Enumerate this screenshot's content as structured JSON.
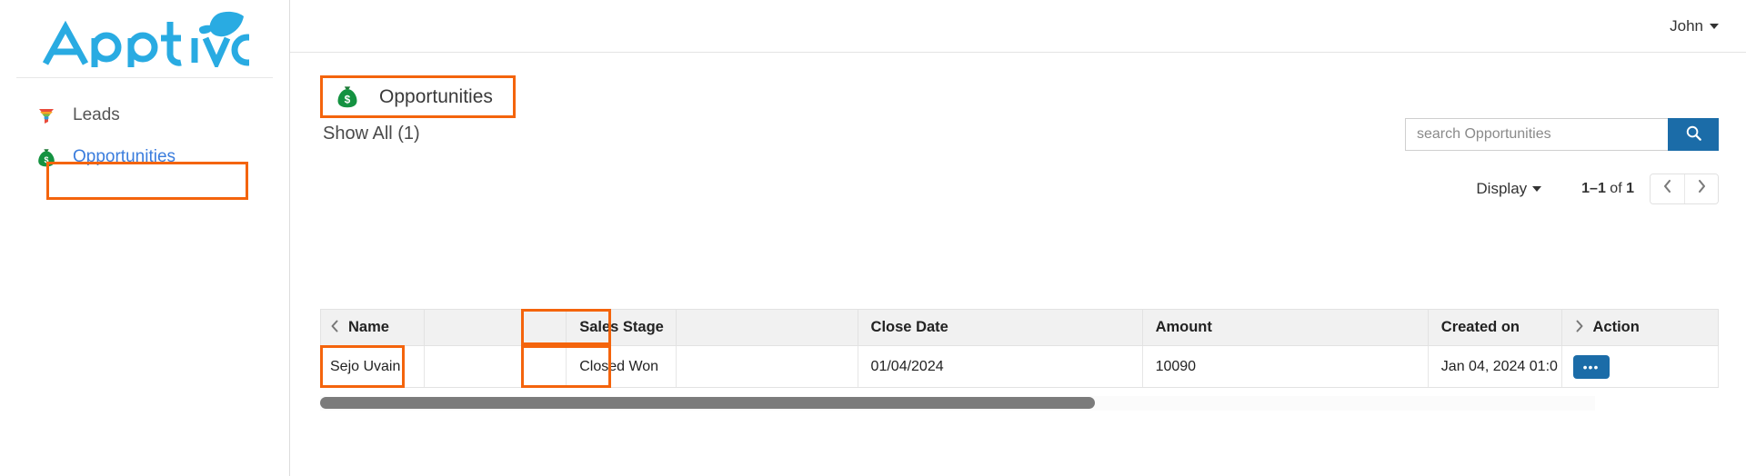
{
  "brand": {
    "name": "Apptivo",
    "logo_color": "#29abe2",
    "leaf_color": "#29abe2"
  },
  "colors": {
    "accent_blue": "#1b6ca8",
    "link_blue": "#3b7ddd",
    "highlight_orange": "#f4640c",
    "header_grey": "#f1f1f1"
  },
  "sidebar": {
    "items": [
      {
        "label": "Leads",
        "icon": "funnel-icon",
        "active": false
      },
      {
        "label": "Opportunities",
        "icon": "money-bag-icon",
        "active": true
      }
    ]
  },
  "topbar": {
    "user_label": "John",
    "caret_icon": "chevron-down-icon"
  },
  "page": {
    "title": "Opportunities",
    "title_icon": "money-bag-icon",
    "show_all": "Show All (1)"
  },
  "search": {
    "placeholder": "search Opportunities",
    "value": "",
    "button_icon": "search-icon"
  },
  "toolbar": {
    "display_label": "Display",
    "display_caret_icon": "chevron-down-icon",
    "range_prefix": "1–1",
    "range_middle": " of ",
    "range_total": "1",
    "prev_icon": "chevron-left-icon",
    "next_icon": "chevron-right-icon"
  },
  "table": {
    "left_scroll_icon": "chevron-left-icon",
    "right_scroll_icon": "chevron-right-icon",
    "columns": [
      {
        "key": "name",
        "label": "Name"
      },
      {
        "key": "blank1",
        "label": ""
      },
      {
        "key": "sales_stage",
        "label": "Sales Stage"
      },
      {
        "key": "blank2",
        "label": ""
      },
      {
        "key": "close_date",
        "label": "Close Date"
      },
      {
        "key": "amount",
        "label": "Amount"
      },
      {
        "key": "created_on",
        "label": "Created on"
      },
      {
        "key": "action",
        "label": "Action"
      }
    ],
    "rows": [
      {
        "name": "Sejo Uvain",
        "blank1": "",
        "sales_stage": "Closed Won",
        "blank2": "",
        "close_date": "01/04/2024",
        "amount": "10090",
        "created_on": "Jan 04, 2024 01:0",
        "action_label": "•••"
      }
    ]
  },
  "scrollbar": {
    "orientation": "horizontal"
  }
}
